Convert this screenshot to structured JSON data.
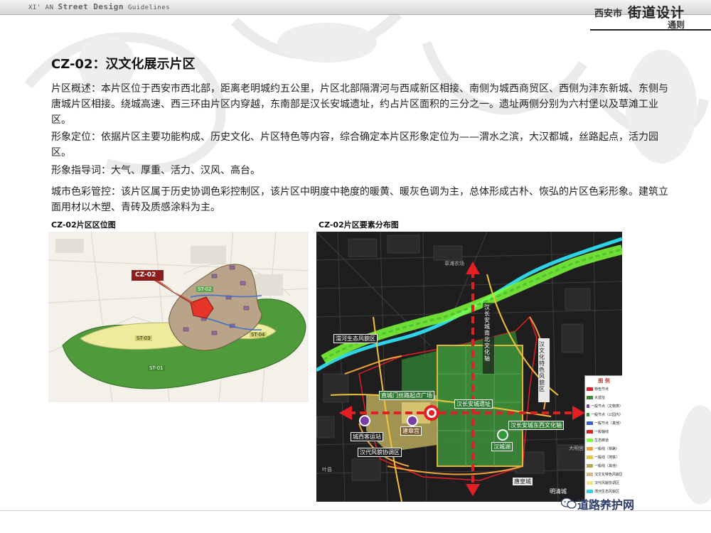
{
  "header": {
    "series_prefix": "XI' AN",
    "series_title": "Street Design",
    "series_suffix": "Guidelines",
    "city": "西安市",
    "title": "街道设计",
    "subtitle": "通则"
  },
  "section": {
    "title": "CZ-02：汉文化展示片区",
    "paragraphs": [
      "片区概述：本片区位于西安市西北部，距离老明城约五公里，片区北部隔渭河与西咸新区相接、南侧为城西商贸区、西侧为沣东新城、东侧与唐城片区相接。绕城高速、西三环由片区内穿越，东南部是汉长安城遗址，约占片区面积的三分之一。遗址两侧分别为六村堡以及草滩工业区。",
      "形象定位：依据片区主要功能构成、历史文化、片区特色等内容，综合确定本片区形象定位为——渭水之滨，大汉都城，丝路起点，活力园区。",
      "形象指导词：大气、厚重、活力、汉风、高台。",
      "城市色彩管控：该片区属于历史协调色彩控制区，该片区中明度中艳度的暖黄、暖灰色调为主，总体形成古朴、恢弘的片区色彩形象。建筑立面用材以木塑、青砖及质感涂料为主。"
    ]
  },
  "left_map": {
    "caption": "CZ-02片区区位图",
    "callout": "CZ-02",
    "zones": [
      "ST-02",
      "ST-03",
      "ST-04",
      "ST-01"
    ]
  },
  "right_map": {
    "caption": "CZ-02片区要素分布图",
    "labels": {
      "weihe_zone": "渭河生态风貌区",
      "north_south_axis": "汉长安城南北文化轴",
      "culture_zone": "汉文化特色风貌区",
      "plaza": "直城门丝路起点广场",
      "site": "汉长安城遗址",
      "east_west_axis": "汉长安城东西文化轴",
      "west_station": "城西客运站",
      "palace": "建章宫",
      "han_style": "汉代风貌协调区",
      "lake": "汉城湖",
      "tang_city": "唐皇城",
      "ming_city": "明清城",
      "farmland": "草滩农场",
      "daming": "大明宫",
      "yexian": "叶县"
    },
    "legend": {
      "title": "图 例",
      "items": [
        "特色节点",
        "大遗址",
        "一般节点（文物类）",
        "一般节点（公园内）",
        "一般节点（其他）",
        "一般轴线",
        "生态廊道",
        "一般线（铁路）",
        "一般线（地铁）",
        "一般线（其他）",
        "汉文化特色风貌区",
        "汉代风貌协调区",
        "渭河生态风貌区"
      ]
    }
  },
  "watermark": {
    "text": "道路养护网"
  },
  "colors": {
    "accent_red": "#e31e24",
    "site_green": "#2e7d32",
    "eco_green": "#7dff3a",
    "dark_map": "#1e1e1e",
    "axis_yellow": "#f2c33a"
  }
}
